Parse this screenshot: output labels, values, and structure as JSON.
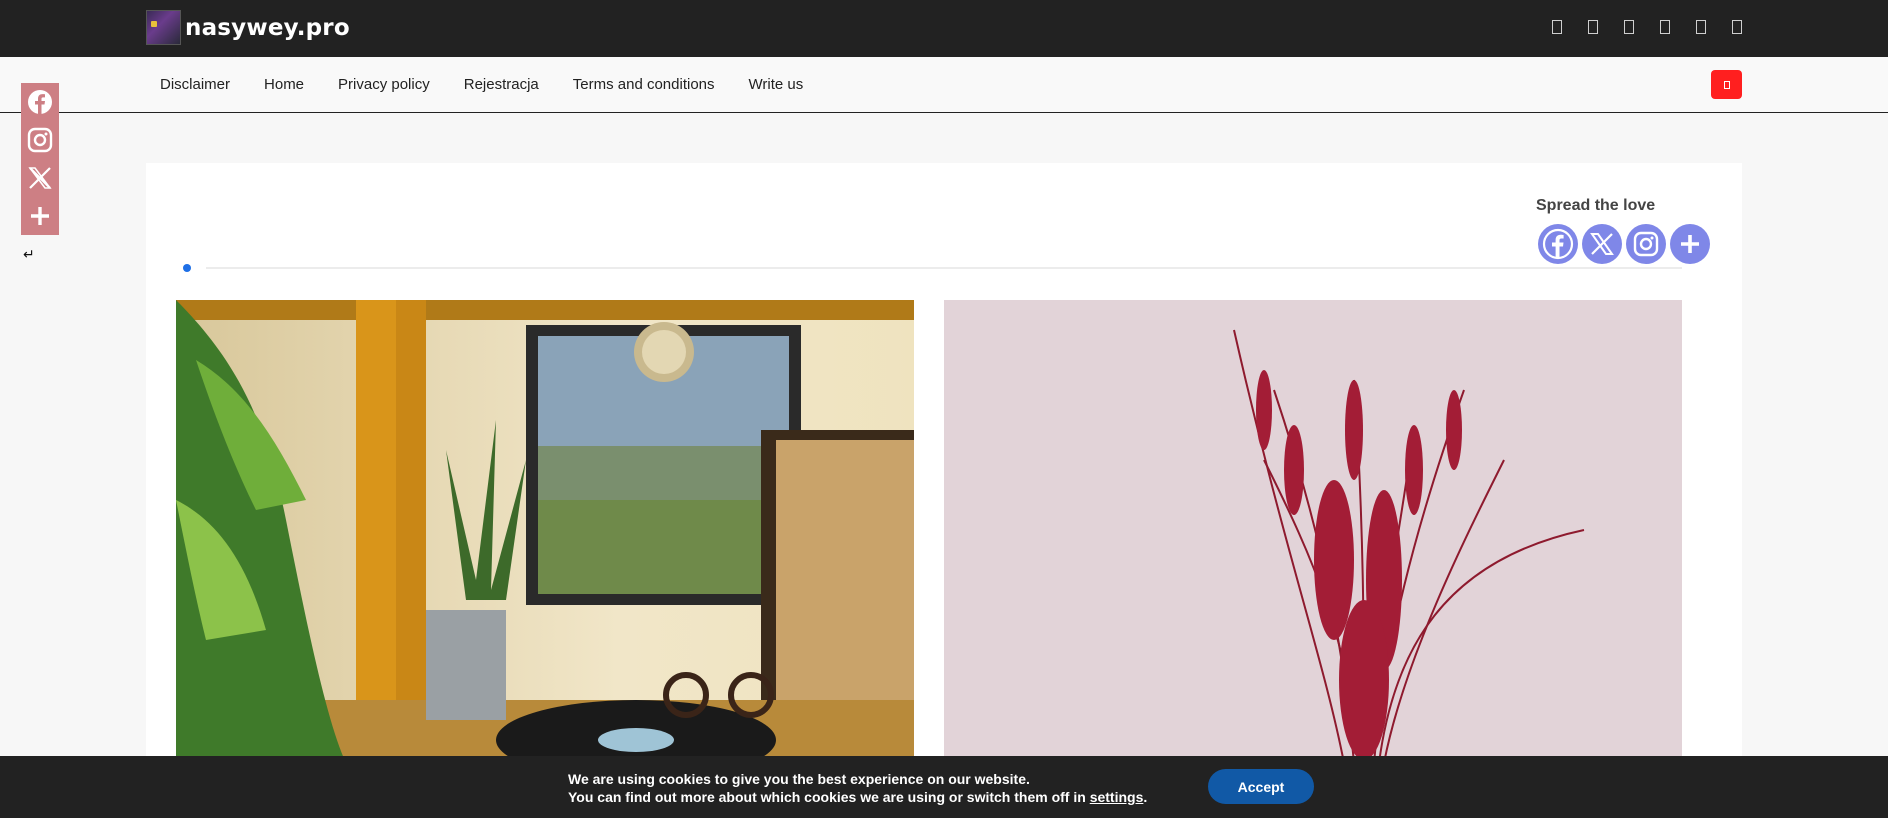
{
  "header": {
    "site_title": "nasywey.pro",
    "social_icons": [
      "icon-1",
      "icon-2",
      "icon-3",
      "icon-4",
      "icon-5",
      "icon-6"
    ]
  },
  "nav": {
    "items": [
      {
        "label": "Disclaimer"
      },
      {
        "label": "Home"
      },
      {
        "label": "Privacy policy"
      },
      {
        "label": "Rejestracja"
      },
      {
        "label": "Terms and conditions"
      },
      {
        "label": "Write us"
      }
    ],
    "search_icon": "search-icon"
  },
  "floating_share": {
    "icons": [
      "facebook-icon",
      "instagram-icon",
      "x-icon",
      "plus-icon"
    ],
    "collapse_glyph": "↵"
  },
  "share": {
    "title": "Spread the love",
    "icons": [
      "facebook-icon",
      "x-icon",
      "instagram-icon",
      "plus-icon"
    ]
  },
  "colors": {
    "topbar": "#222222",
    "accent_red": "#ff1f1f",
    "share_purple": "#7f87e8",
    "floating_share_bg": "#cd7f84",
    "accept_blue": "#1159a6",
    "progress_blue": "#1e6fe6"
  },
  "cookie": {
    "line1": "We are using cookies to give you the best experience on our website.",
    "line2_prefix": "You can find out more about which cookies we are using or switch them off in ",
    "link": "settings",
    "line2_suffix": ".",
    "accept_label": "Accept"
  }
}
